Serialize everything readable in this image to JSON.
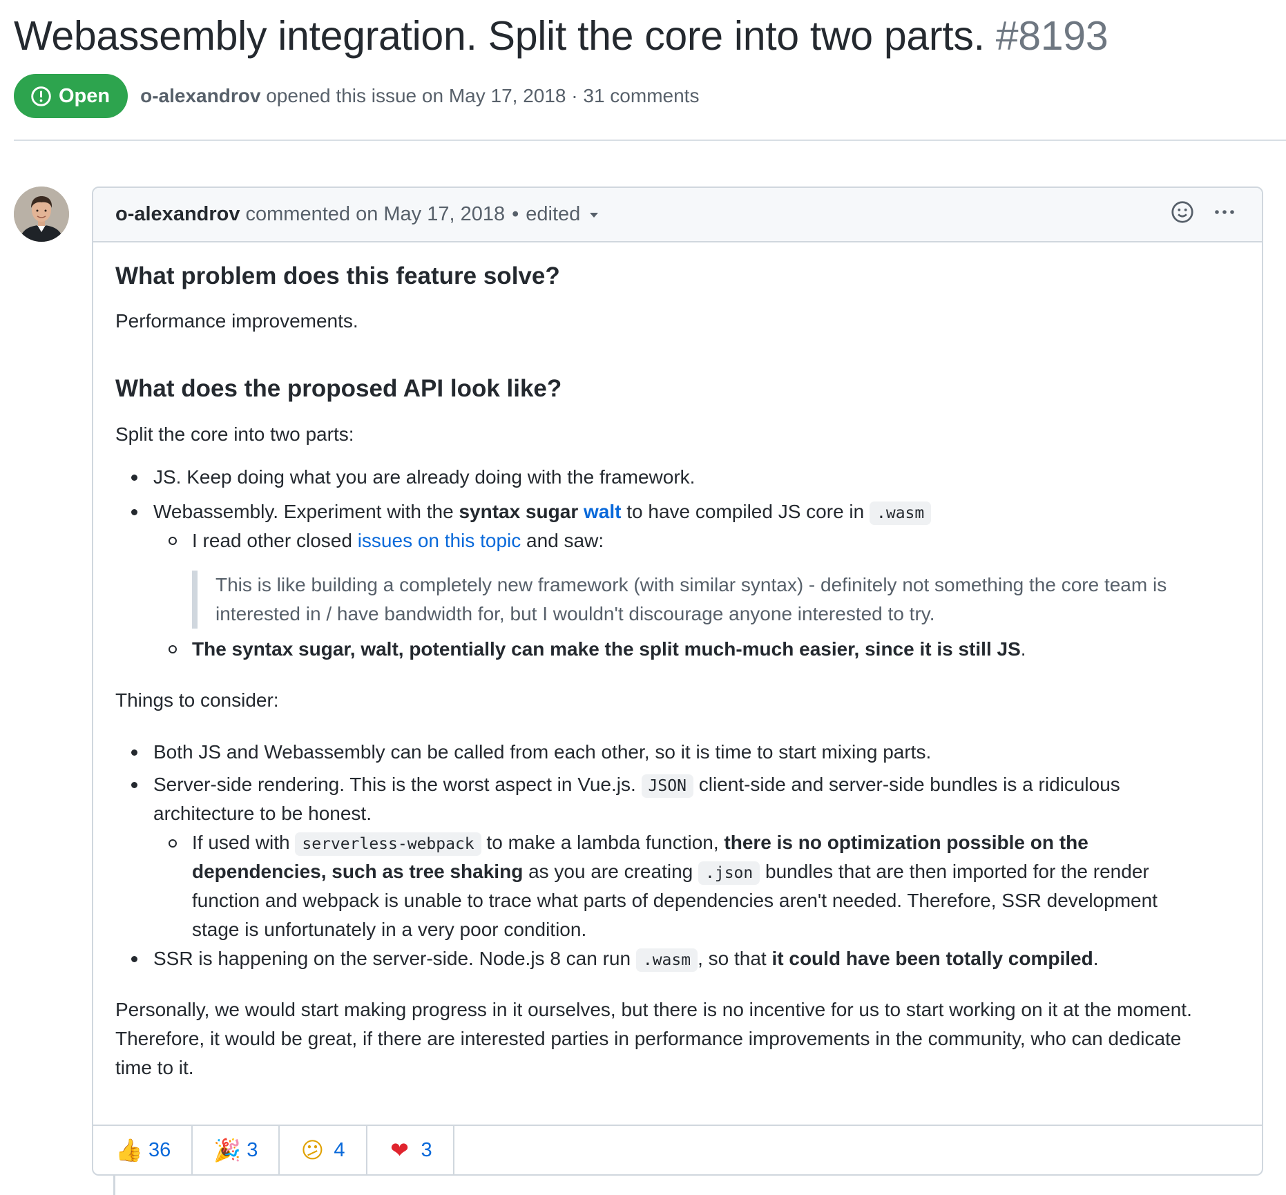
{
  "issue": {
    "title": "Webassembly integration. Split the core into two parts.",
    "number": "#8193",
    "state": "Open",
    "author": "o-alexandrov",
    "opened_text": "opened this issue on May 17, 2018 · 31 comments"
  },
  "comment": {
    "author": "o-alexandrov",
    "commented_text": "commented on May 17, 2018",
    "edited": "edited",
    "h1": "What problem does this feature solve?",
    "p1": "Performance improvements.",
    "h2": "What does the proposed API look like?",
    "p2": "Split the core into two parts:",
    "li1": "JS. Keep doing what you are already doing with the framework.",
    "li2_a": "Webassembly. Experiment with the ",
    "li2_b": "syntax sugar",
    "li2_link": "walt",
    "li2_c": " to have compiled JS core in ",
    "li2_code": ".wasm",
    "sub1_a": "I read other closed ",
    "sub1_link": "issues on this topic",
    "sub1_b": " and saw:",
    "quote_l1": "This is like building a completely new framework (with similar syntax) - definitely not something the core team is",
    "quote_l2": "interested in / have bandwidth for, but I wouldn't discourage anyone interested to try.",
    "sub2": "The syntax sugar, walt, potentially can make the split much-much easier, since it is still JS",
    "sub2_end": ".",
    "p3": "Things to consider:",
    "t1": "Both JS and Webassembly can be called from each other, so it is time to start mixing parts.",
    "t2_a": "Server-side rendering. This is the worst aspect in Vue.js. ",
    "t2_code": "JSON",
    "t2_b": " client-side and server-side bundles is a ridiculous",
    "t2_l2": "architecture to be honest.",
    "s1_a": "If used with ",
    "s1_code": "serverless-webpack",
    "s1_b": " to make a lambda function, ",
    "s1_bold1": "there is no optimization possible on the",
    "s1_bold2": "dependencies, such as tree shaking",
    "s1_c": " as you are creating ",
    "s1_code2": ".json",
    "s1_d": " bundles that are then imported for the render",
    "s1_l3": "function and webpack is unable to trace what parts of dependencies aren't needed. Therefore, SSR development",
    "s1_l4": "stage is unfortunately in a very poor condition.",
    "t3_a": "SSR is happening on the server-side. Node.js 8 can run ",
    "t3_code": ".wasm",
    "t3_b": ", so that ",
    "t3_bold": "it could have been totally compiled",
    "t3_end": ".",
    "p4_l1": "Personally, we would start making progress in it ourselves, but there is no incentive for us to start working on it at the moment.",
    "p4_l2": "Therefore, it would be great, if there are interested parties in performance improvements in the community, who can dedicate",
    "p4_l3": "time to it."
  },
  "reactions": [
    {
      "emoji": "👍",
      "icon": "thumbs-up-icon",
      "count": "36"
    },
    {
      "emoji": "🎉",
      "icon": "party-popper-icon",
      "count": "3"
    },
    {
      "emoji": "😕",
      "icon": "confused-face-icon",
      "count": "4"
    },
    {
      "emoji": "❤",
      "icon": "heart-icon",
      "count": "3"
    }
  ],
  "colors": {
    "open_green": "#2da44e",
    "link_blue": "#0969da",
    "muted": "#57606a"
  }
}
